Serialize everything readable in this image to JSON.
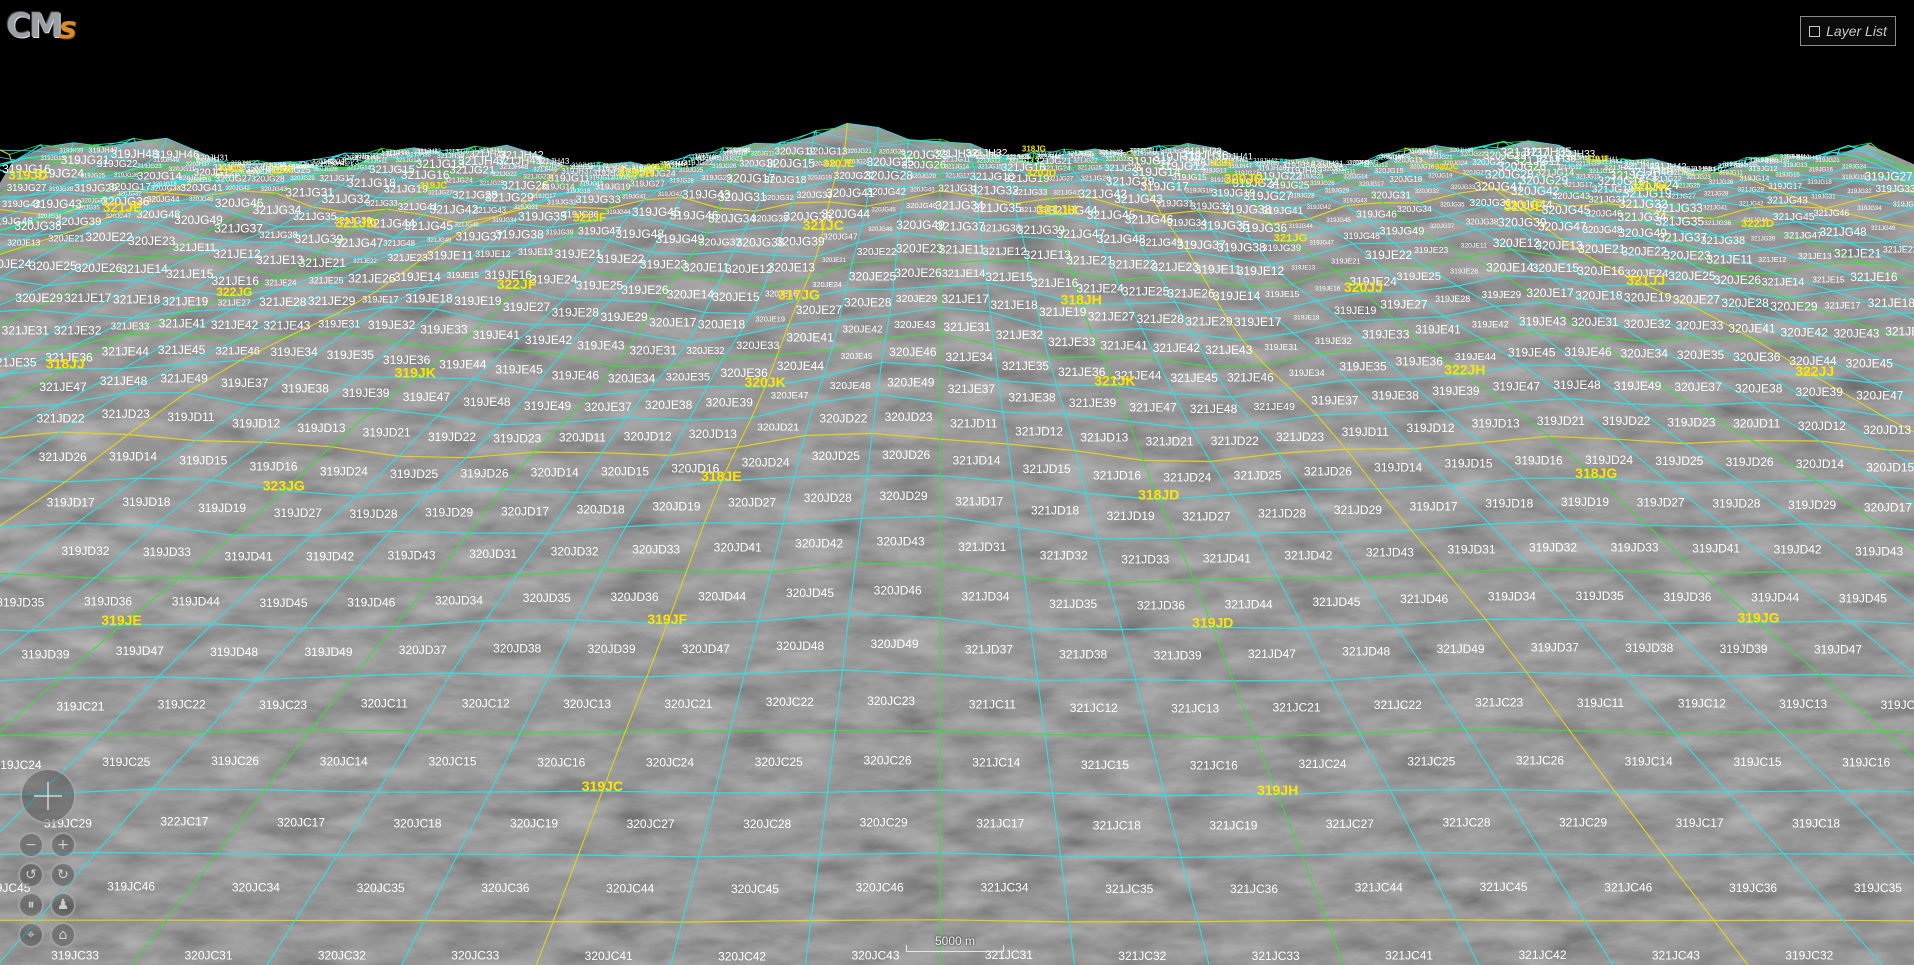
{
  "app": {
    "logo_text_cm": "CM",
    "logo_text_s": "s"
  },
  "layer_list": {
    "label": "Layer List"
  },
  "scale_bar": {
    "label": "5000 m"
  },
  "colors": {
    "sky": "#000000",
    "grid_minor": "#2fe0e6",
    "grid_mid": "#3ddc3d",
    "grid_major": "#e6d21e",
    "label_minor": "#ffffff",
    "label_major": "#ffe600"
  },
  "nav_controls": [
    {
      "name": "pan-control",
      "icon": "pan-icon"
    },
    {
      "name": "zoom-out-button",
      "icon": "minus-icon",
      "glyph": "−"
    },
    {
      "name": "zoom-in-button",
      "icon": "plus-icon",
      "glyph": "+"
    },
    {
      "name": "rotate-left-button",
      "icon": "rotate-left-icon",
      "glyph": "↺"
    },
    {
      "name": "rotate-right-button",
      "icon": "rotate-right-icon",
      "glyph": "↻"
    },
    {
      "name": "tilt-button",
      "icon": "tilt-icon",
      "glyph": "⏸"
    },
    {
      "name": "person-button",
      "icon": "person-icon",
      "glyph": "♟"
    },
    {
      "name": "compass-button",
      "icon": "compass-icon",
      "glyph": "⌖"
    },
    {
      "name": "home-button",
      "icon": "home-icon",
      "glyph": "⌂"
    }
  ],
  "map": {
    "major_labels": [
      "318JE",
      "318JD",
      "318JG",
      "319JE",
      "319JF",
      "319JD",
      "319JG",
      "319JC",
      "319JH",
      "320JE",
      "320JD",
      "320JG",
      "320JC",
      "320JH",
      "321JE",
      "321JD",
      "321JF",
      "321JC",
      "321JH",
      "321JG",
      "322JE",
      "322JD",
      "322JG",
      "322JF",
      "317JG",
      "318JH",
      "320JJ",
      "321JJ",
      "318JJ",
      "319JK",
      "320JK",
      "321JK",
      "322JH",
      "322JJ",
      "323JG"
    ],
    "cell_labels": [
      [
        "320JC31",
        "320JC32",
        "320JC33",
        "320JC41",
        "320JC42",
        "320JC43",
        "321JC31",
        "321JC32",
        "321JC33",
        "321JC41",
        "321JC42",
        "321JC43",
        "319JC32",
        "319JC31",
        "319JC41",
        "319JC42",
        "319JC43",
        "319JC33"
      ],
      [
        "320JC34",
        "320JC35",
        "320JC36",
        "320JC44",
        "320JC45",
        "320JC46",
        "321JC34",
        "321JC35",
        "321JC36",
        "321JC44",
        "321JC45",
        "321JC46",
        "319JC36",
        "319JC35",
        "319JC34",
        "319JC44",
        "319JC45",
        "319JC46"
      ],
      [
        "320JC17",
        "320JC18",
        "320JC19",
        "320JC27",
        "320JC28",
        "320JC29",
        "321JC17",
        "321JC18",
        "321JC19",
        "321JC27",
        "321JC28",
        "321JC29",
        "319JC17",
        "319JC18",
        "319JC27",
        "319JC28",
        "319JC29",
        "322JC17"
      ],
      [
        "320JC14",
        "320JC15",
        "320JC16",
        "320JC24",
        "320JC25",
        "320JC26",
        "321JC14",
        "321JC15",
        "321JC16",
        "321JC24",
        "321JC25",
        "321JC26",
        "319JC14",
        "319JC15",
        "319JC16",
        "319JC24",
        "319JC25",
        "319JC26"
      ],
      [
        "320JC11",
        "320JC12",
        "320JC13",
        "320JC21",
        "320JC22",
        "320JC23",
        "321JC11",
        "321JC12",
        "321JC13",
        "321JC21",
        "321JC22",
        "321JC23",
        "319JC11",
        "319JC12",
        "319JC13",
        "319JC21",
        "319JC22",
        "319JC23"
      ],
      [
        "320JD37",
        "320JD38",
        "320JD39",
        "320JD47",
        "320JD48",
        "320JD49",
        "321JD37",
        "321JD38",
        "321JD39",
        "321JD47",
        "321JD48",
        "321JD49",
        "319JD37",
        "319JD38",
        "319JD39",
        "319JD47",
        "319JD48",
        "319JD49"
      ],
      [
        "320JD34",
        "320JD35",
        "320JD36",
        "320JD44",
        "320JD45",
        "320JD46",
        "321JD34",
        "321JD35",
        "321JD36",
        "321JD44",
        "321JD45",
        "321JD46",
        "319JD34",
        "319JD35",
        "319JD36",
        "319JD44",
        "319JD45",
        "319JD46"
      ],
      [
        "320JD31",
        "320JD32",
        "320JD33",
        "320JD41",
        "320JD42",
        "320JD43",
        "321JD31",
        "321JD32",
        "321JD33",
        "321JD41",
        "321JD42",
        "321JD43",
        "319JD31",
        "319JD32",
        "319JD33",
        "319JD41",
        "319JD42",
        "319JD43"
      ],
      [
        "320JD17",
        "320JD18",
        "320JD19",
        "320JD27",
        "320JD28",
        "320JD29",
        "321JD17",
        "321JD18",
        "321JD19",
        "321JD27",
        "321JD28",
        "321JD29",
        "319JD17",
        "319JD18",
        "319JD19",
        "319JD27",
        "319JD28",
        "319JD29"
      ],
      [
        "320JD14",
        "320JD15",
        "320JD16",
        "320JD24",
        "320JD25",
        "320JD26",
        "321JD14",
        "321JD15",
        "321JD16",
        "321JD24",
        "321JD25",
        "321JD26",
        "319JD14",
        "319JD15",
        "319JD16",
        "319JD24",
        "319JD25",
        "319JD26"
      ],
      [
        "320JD11",
        "320JD12",
        "320JD13",
        "320JD21",
        "320JD22",
        "320JD23",
        "321JD11",
        "321JD12",
        "321JD13",
        "321JD21",
        "321JD22",
        "321JD23",
        "319JD11",
        "319JD12",
        "319JD13",
        "319JD21",
        "319JD22",
        "319JD23"
      ],
      [
        "320JE37",
        "320JE38",
        "320JE39",
        "320JE47",
        "320JE48",
        "320JE49",
        "321JE37",
        "321JE38",
        "321JE39",
        "321JE47",
        "321JE48",
        "321JE49",
        "319JE37",
        "319JE38",
        "319JE39",
        "319JE47",
        "319JE48",
        "319JE49"
      ],
      [
        "320JE34",
        "320JE35",
        "320JE36",
        "320JE44",
        "320JE45",
        "320JE46",
        "321JE34",
        "321JE35",
        "321JE36",
        "321JE44",
        "321JE45",
        "321JE46",
        "319JE34",
        "319JE35",
        "319JE36",
        "319JE44",
        "319JE45",
        "319JE46"
      ],
      [
        "320JE31",
        "320JE32",
        "320JE33",
        "320JE41",
        "320JE42",
        "320JE43",
        "321JE31",
        "321JE32",
        "321JE33",
        "321JE41",
        "321JE42",
        "321JE43",
        "319JE31",
        "319JE32",
        "319JE33",
        "319JE41",
        "319JE42",
        "319JE43"
      ],
      [
        "320JE17",
        "320JE18",
        "320JE19",
        "320JE27",
        "320JE28",
        "320JE29",
        "321JE17",
        "321JE18",
        "321JE19",
        "321JE27",
        "321JE28",
        "321JE29",
        "319JE17",
        "319JE18",
        "319JE19",
        "319JE27",
        "319JE28",
        "319JE29"
      ],
      [
        "320JE14",
        "320JE15",
        "320JE16",
        "320JE24",
        "320JE25",
        "320JE26",
        "321JE14",
        "321JE15",
        "321JE16",
        "321JE24",
        "321JE25",
        "321JE26",
        "319JE14",
        "319JE15",
        "319JE16",
        "319JE24",
        "319JE25",
        "319JE26"
      ],
      [
        "320JE11",
        "320JE12",
        "320JE13",
        "320JE21",
        "320JE22",
        "320JE23",
        "321JE11",
        "321JE12",
        "321JE13",
        "321JE21",
        "321JE22",
        "321JE23",
        "319JE11",
        "319JE12",
        "319JE13",
        "319JE21",
        "319JE22",
        "319JE23"
      ],
      [
        "320JG37",
        "320JG38",
        "320JG39",
        "320JG47",
        "320JG48",
        "320JG49",
        "321JG37",
        "321JG38",
        "321JG39",
        "321JG47",
        "321JG48",
        "321JG49",
        "319JG37",
        "319JG38",
        "319JG39",
        "319JG47",
        "319JG48",
        "319JG49"
      ],
      [
        "320JG34",
        "320JG35",
        "320JG36",
        "320JG44",
        "320JG45",
        "320JG46",
        "321JG34",
        "321JG35",
        "321JG36",
        "321JG44",
        "321JG45",
        "321JG46",
        "319JG34",
        "319JG35",
        "319JG36",
        "319JG44",
        "319JG45",
        "319JG46"
      ],
      [
        "320JG31",
        "320JG32",
        "320JG33",
        "320JG41",
        "320JG42",
        "320JG43",
        "321JG31",
        "321JG32",
        "321JG33",
        "321JG41",
        "321JG42",
        "321JG43",
        "319JG31",
        "319JG32",
        "319JG33",
        "319JG41",
        "319JG42",
        "319JG43"
      ],
      [
        "320JG17",
        "320JG18",
        "320JG19",
        "320JG27",
        "320JG28",
        "320JG29",
        "321JG17",
        "321JG18",
        "321JG19",
        "321JG27",
        "321JG28",
        "321JG29",
        "319JG17",
        "319JG18",
        "319JG19",
        "319JG27",
        "319JG28",
        "319JG29"
      ],
      [
        "320JG14",
        "320JG15",
        "320JG16",
        "320JG24",
        "320JG25",
        "320JG26",
        "321JG14",
        "321JG15",
        "321JG16",
        "321JG24",
        "321JG25",
        "321JG26",
        "319JG14",
        "319JG15",
        "319JG16",
        "319JG24",
        "319JG25",
        "319JG26"
      ],
      [
        "320JG11",
        "320JG12",
        "320JG13",
        "320JG21",
        "320JG22",
        "320JG23",
        "321JG11",
        "321JG12",
        "321JG13",
        "321JG21",
        "321JG22",
        "321JG23",
        "319JG11",
        "319JG12",
        "319JG13",
        "319JG21",
        "319JG22",
        "319JG23"
      ],
      [
        "320JH37",
        "320JH38",
        "320JH39",
        "320JH47",
        "320JH48",
        "320JH49",
        "321JH37",
        "321JH38",
        "321JH39",
        "321JH47",
        "321JH48",
        "321JH49",
        "319JH37",
        "319JH38",
        "319JH39",
        "319JH47",
        "319JH48",
        "319JH49"
      ],
      [
        "320JH34",
        "320JH35",
        "320JH36",
        "320JH44",
        "320JH45",
        "320JH46",
        "321JH34",
        "321JH35",
        "321JH36",
        "321JH44",
        "321JH45",
        "321JH46",
        "319JH34",
        "319JH35",
        "319JH36",
        "319JH44",
        "319JH45",
        "319JH46"
      ],
      [
        "320JH31",
        "320JH32",
        "320JH33",
        "320JH41",
        "320JH42",
        "320JH43",
        "321JH31",
        "321JH32",
        "321JH33",
        "321JH41",
        "321JH42",
        "321JH43",
        "319JH31",
        "319JH32",
        "319JH33",
        "319JH41",
        "319JH42",
        "319JH43"
      ]
    ]
  }
}
